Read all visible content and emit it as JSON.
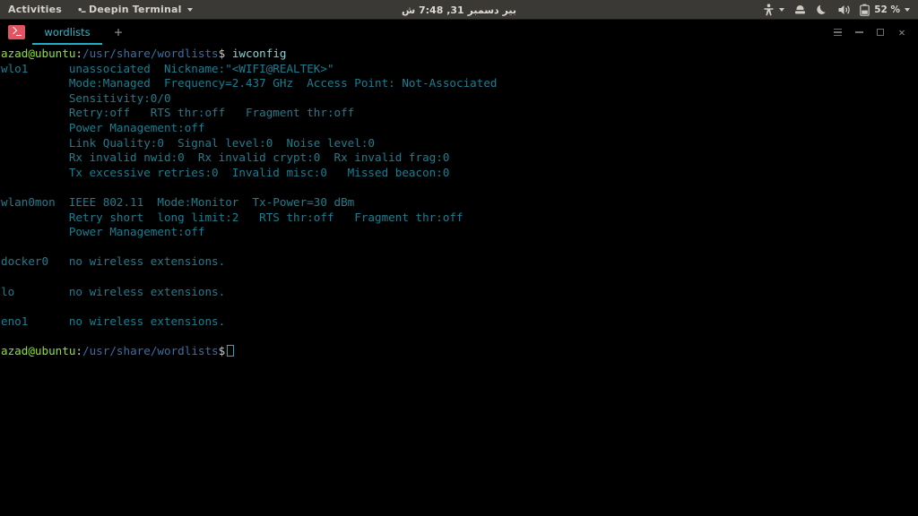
{
  "topbar": {
    "activities_label": "Activities",
    "app_name": "Deepin Terminal",
    "clock": "بير دسمبر 31, 7:48 ش",
    "battery_percent": "52 %",
    "icons": {
      "app_indicator": "terminal-dot-icon",
      "app_menu_caret": "chevron-down-icon",
      "accessibility": "accessibility-icon",
      "accessibility_caret": "chevron-down-icon",
      "network": "network-icon",
      "night_light": "moon-icon",
      "volume": "speaker-icon",
      "battery": "battery-icon",
      "system_caret": "chevron-down-icon"
    }
  },
  "window": {
    "tab": {
      "icon": "deepin-terminal-icon",
      "label": "wordlists",
      "active": true
    },
    "new_tab_label": "+",
    "controls": {
      "menu": "hamburger-menu-icon",
      "minimize": "minimize-icon",
      "maximize": "maximize-icon",
      "close": "close-icon"
    }
  },
  "terminal": {
    "prompt": {
      "user_host": "azad@ubuntu",
      "separator": ":",
      "path": "/usr/share/wordlists",
      "sigil": "$"
    },
    "command": "iwconfig",
    "lines": [
      "wlo1      unassociated  Nickname:\"<WIFI@REALTEK>\"",
      "          Mode:Managed  Frequency=2.437 GHz  Access Point: Not-Associated",
      "          Sensitivity:0/0",
      "          Retry:off   RTS thr:off   Fragment thr:off",
      "          Power Management:off",
      "          Link Quality:0  Signal level:0  Noise level:0",
      "          Rx invalid nwid:0  Rx invalid crypt:0  Rx invalid frag:0",
      "          Tx excessive retries:0  Invalid misc:0   Missed beacon:0",
      "",
      "wlan0mon  IEEE 802.11  Mode:Monitor  Tx-Power=30 dBm",
      "          Retry short  long limit:2   RTS thr:off   Fragment thr:off",
      "          Power Management:off",
      "",
      "docker0   no wireless extensions.",
      "",
      "lo        no wireless extensions.",
      "",
      "eno1      no wireless extensions.",
      ""
    ]
  },
  "colors": {
    "topbar_bg": "#3a3935",
    "terminal_bg": "#000000",
    "terminal_fg": "#1c7f91",
    "prompt_user": "#8ae234",
    "prompt_path": "#3b6ea5",
    "tab_accent": "#1fafc4",
    "tab_icon": "#e05561"
  }
}
